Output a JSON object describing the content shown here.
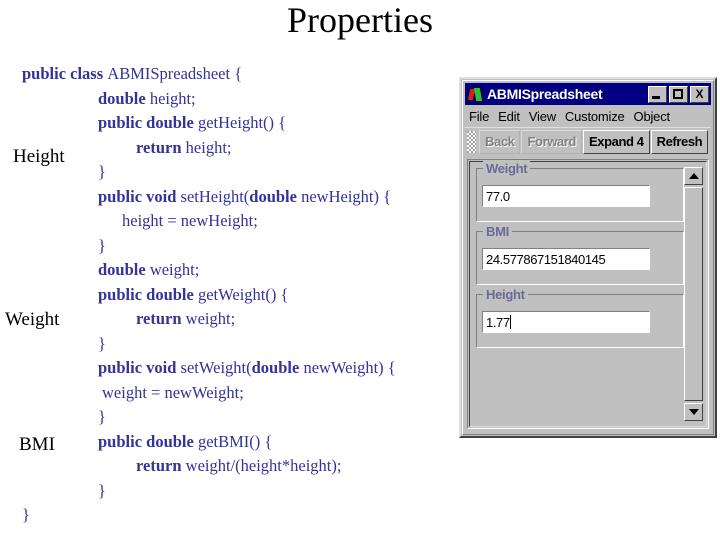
{
  "slide": {
    "title": "Properties",
    "code_color": "#333399",
    "annotations": [
      {
        "label": "Height"
      },
      {
        "label": "Weight"
      },
      {
        "label": "BMI"
      }
    ],
    "code_lines": [
      {
        "indent": "ind1",
        "segments": [
          {
            "t": "public class ",
            "b": true
          },
          {
            "t": "ABMISpreadsheet {",
            "b": false
          }
        ]
      },
      {
        "indent": "ind2",
        "segments": [
          {
            "t": "double ",
            "b": true
          },
          {
            "t": "height;",
            "b": false
          }
        ]
      },
      {
        "indent": "ind2",
        "segments": [
          {
            "t": "public double ",
            "b": true
          },
          {
            "t": "getHeight() {",
            "b": false
          }
        ]
      },
      {
        "indent": "ind3",
        "segments": [
          {
            "t": "return ",
            "b": true
          },
          {
            "t": "height;",
            "b": false
          }
        ]
      },
      {
        "indent": "ind2",
        "segments": [
          {
            "t": "}",
            "b": false
          }
        ]
      },
      {
        "indent": "ind2",
        "segments": [
          {
            "t": "public void ",
            "b": true
          },
          {
            "t": "setHeight(",
            "b": false
          },
          {
            "t": "double ",
            "b": true
          },
          {
            "t": "newHeight) {",
            "b": false
          }
        ]
      },
      {
        "indent": "ind4",
        "segments": [
          {
            "t": "height = newHeight;",
            "b": false
          }
        ]
      },
      {
        "indent": "ind2",
        "segments": [
          {
            "t": "}",
            "b": false
          }
        ]
      },
      {
        "indent": "ind2",
        "segments": [
          {
            "t": "double ",
            "b": true
          },
          {
            "t": "weight;",
            "b": false
          }
        ]
      },
      {
        "indent": "ind2",
        "segments": [
          {
            "t": "public double ",
            "b": true
          },
          {
            "t": "getWeight() {",
            "b": false
          }
        ]
      },
      {
        "indent": "ind3",
        "segments": [
          {
            "t": "return ",
            "b": true
          },
          {
            "t": "weight;",
            "b": false
          }
        ]
      },
      {
        "indent": "ind2",
        "segments": [
          {
            "t": "}",
            "b": false
          }
        ]
      },
      {
        "indent": "ind2",
        "segments": [
          {
            "t": "public void ",
            "b": true
          },
          {
            "t": "setWeight(",
            "b": false
          },
          {
            "t": "double ",
            "b": true
          },
          {
            "t": "newWeight) {",
            "b": false
          }
        ]
      },
      {
        "indent": "ind5",
        "segments": [
          {
            "t": "weight = newWeight;",
            "b": false
          }
        ]
      },
      {
        "indent": "ind2",
        "segments": [
          {
            "t": "}",
            "b": false
          }
        ]
      },
      {
        "indent": "ind2",
        "segments": [
          {
            "t": "public double ",
            "b": true
          },
          {
            "t": "getBMI() {",
            "b": false
          }
        ]
      },
      {
        "indent": "ind3",
        "segments": [
          {
            "t": "return ",
            "b": true
          },
          {
            "t": "weight/(height*height);",
            "b": false
          }
        ]
      },
      {
        "indent": "ind2",
        "segments": [
          {
            "t": "}",
            "b": false
          }
        ]
      },
      {
        "indent": "ind1",
        "segments": [
          {
            "t": "}",
            "b": false
          }
        ]
      }
    ]
  },
  "app_window": {
    "title": "ABMISpreadsheet",
    "titlebar_color": "#000080",
    "face_color": "#c0c0c0",
    "window_buttons": {
      "minimize": "",
      "maximize": "",
      "close": "X"
    },
    "menu": [
      {
        "label": "File"
      },
      {
        "label": "Edit"
      },
      {
        "label": "View"
      },
      {
        "label": "Customize"
      },
      {
        "label": "Object"
      }
    ],
    "toolbar": [
      {
        "label": "Back",
        "enabled": false
      },
      {
        "label": "Forward",
        "enabled": false
      },
      {
        "label": "Expand 4",
        "enabled": true
      },
      {
        "label": "Refresh",
        "enabled": true
      }
    ],
    "fields": [
      {
        "label": "Weight",
        "value": "77.0",
        "focused": false
      },
      {
        "label": "BMI",
        "value": "24.577867151840145",
        "focused": false
      },
      {
        "label": "Height",
        "value": "1.77",
        "focused": true
      }
    ],
    "scrollbar": {
      "up_arrow": "up-arrow",
      "down_arrow": "down-arrow"
    }
  }
}
